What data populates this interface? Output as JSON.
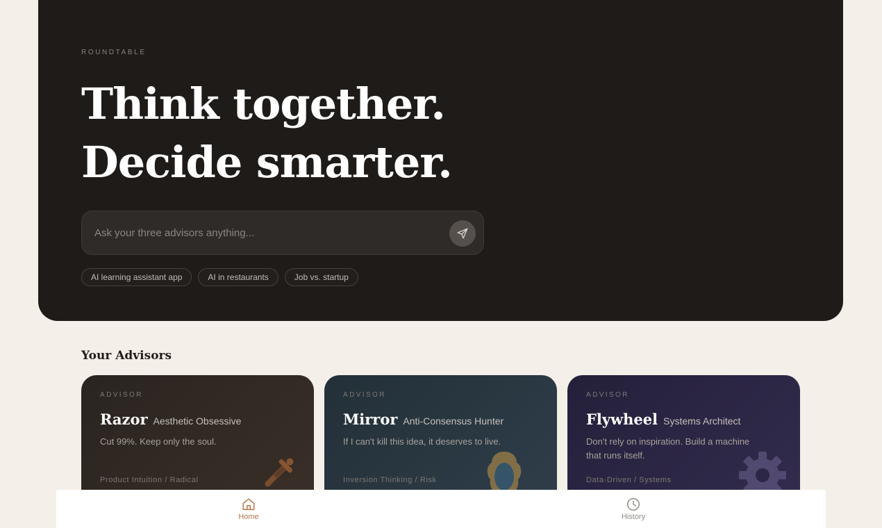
{
  "hero": {
    "eyebrow": "ROUNDTABLE",
    "headline_line1": "Think together.",
    "headline_line2": "Decide smarter.",
    "ask_placeholder": "Ask your three advisors anything...",
    "suggestions": [
      "AI learning assistant app",
      "AI in restaurants",
      "Job vs. startup"
    ]
  },
  "advisors_section": {
    "title": "Your Advisors",
    "cards": [
      {
        "eyebrow": "ADVISOR",
        "name": "Razor",
        "role": "Aesthetic Obsessive",
        "description": "Cut 99%. Keep only the soul.",
        "tags": "Product Intuition / Radical",
        "icon": "dagger-icon",
        "accent": "#c9743a"
      },
      {
        "eyebrow": "ADVISOR",
        "name": "Mirror",
        "role": "Anti-Consensus Hunter",
        "description": "If I can't kill this idea, it deserves to live.",
        "tags": "Inversion Thinking / Risk",
        "icon": "mirror-icon",
        "accent": "#c79a4a"
      },
      {
        "eyebrow": "ADVISOR",
        "name": "Flywheel",
        "role": "Systems Architect",
        "description": "Don't rely on inspiration. Build a machine that runs itself.",
        "tags": "Data-Driven / Systems",
        "icon": "gear-icon",
        "accent": "#6c6490"
      }
    ]
  },
  "bottom_nav": {
    "items": [
      {
        "label": "Home",
        "icon": "home-icon",
        "active": true
      },
      {
        "label": "History",
        "icon": "clock-icon",
        "active": false
      }
    ]
  },
  "colors": {
    "page_bg": "#f4efe9",
    "hero_bg": "#1f1b18",
    "nav_active": "#b8754a"
  }
}
